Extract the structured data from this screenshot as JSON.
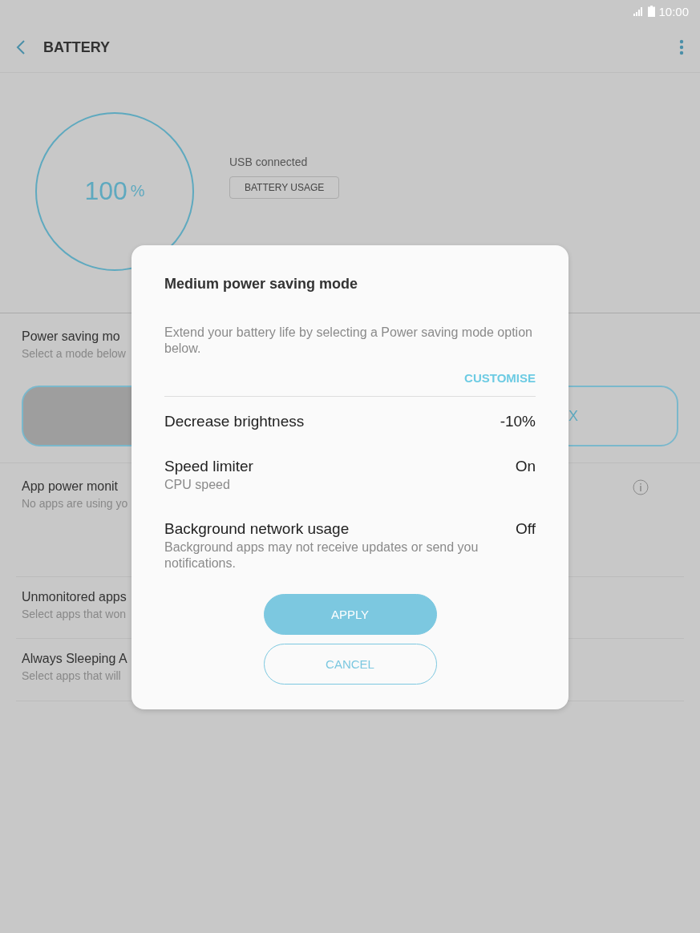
{
  "status_bar": {
    "time": "10:00"
  },
  "header": {
    "title": "BATTERY"
  },
  "battery": {
    "percent": "100",
    "unit": "%",
    "status": "USB connected",
    "usage_button": "BATTERY USAGE"
  },
  "power_saving": {
    "title": "Power saving mo",
    "subtitle": "Select a mode below",
    "modes": [
      {
        "selected": true
      },
      {
        "label": "X",
        "selected": false
      }
    ]
  },
  "sections": [
    {
      "title": "App power monit",
      "subtitle": "No apps are using yo",
      "info": true
    },
    {
      "title": "Unmonitored apps",
      "subtitle": "Select apps that won",
      "info": false
    },
    {
      "title": "Always Sleeping A",
      "subtitle": "Select apps that will",
      "info": false
    }
  ],
  "dialog": {
    "title": "Medium power saving mode",
    "description": "Extend your battery life by selecting a Power saving mode option below.",
    "link": "CUSTOMISE",
    "options": [
      {
        "label": "Decrease brightness",
        "value": "-10%"
      },
      {
        "label": "Speed limiter",
        "detail": "CPU speed",
        "value": "On"
      },
      {
        "label": "Background network usage",
        "detail": "Background apps may not receive updates or send you notifications.",
        "value": "Off"
      }
    ],
    "buttons": [
      {
        "label": "APPLY",
        "kind": "primary"
      },
      {
        "label": "CANCEL",
        "kind": "outline"
      }
    ]
  }
}
